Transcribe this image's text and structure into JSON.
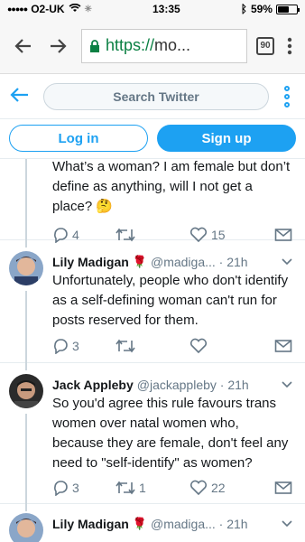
{
  "status": {
    "carrier": "O2-UK",
    "time": "13:35",
    "battery": "59%",
    "battery_level": 0.59
  },
  "browser": {
    "url_https": "https://",
    "url_rest": "mo...",
    "tab_count": "90"
  },
  "header": {
    "search_placeholder": "Search Twitter"
  },
  "auth": {
    "login": "Log in",
    "signup": "Sign up"
  },
  "tweets": [
    {
      "text": "What’s a woman? I am female but don’t define as anything, will I not get a place? 🤔",
      "replies": "4",
      "retweets": "",
      "likes": "15"
    },
    {
      "name": "Lily Madigan",
      "handle": "@madiga... · 21h",
      "text": "Unfortunately, people who don't identify as a self-defining woman can't run for posts reserved for them.",
      "replies": "3",
      "retweets": "",
      "likes": ""
    },
    {
      "name": "Jack Appleby",
      "handle": "@jackappleby · 21h",
      "text": "So you'd agree this rule favours trans women over natal women who, because they are female, don't feel any need to \"self-identify\" as women?",
      "replies": "3",
      "retweets": "1",
      "likes": "22"
    },
    {
      "name": "Lily Madigan",
      "handle": "@madiga... · 21h"
    }
  ],
  "colors": {
    "accent": "#1da1f2",
    "secondary_text": "#657786",
    "rose": "#c0202a"
  }
}
